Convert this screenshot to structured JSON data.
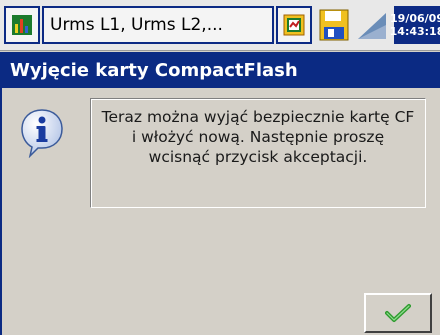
{
  "topbar": {
    "channels_label": "Urms L1, Urms L2,...",
    "clock": {
      "date": "19/06/09",
      "time": "14:43:18"
    },
    "icons": {
      "app": "chart-icon",
      "view": "view-switch-icon",
      "save": "floppy-disk-icon",
      "signal": "signal-icon",
      "alarm": "alarm-icon"
    }
  },
  "dialog": {
    "title": "Wyjęcie karty CompactFlash",
    "message": "Teraz można wyjąć bezpiecznie kartę CF i włożyć nową. Następnie proszę wcisnąć przycisk akceptacji.",
    "icon": "info-icon",
    "ok_icon": "checkmark-icon"
  },
  "colors": {
    "accent": "#0b2a83",
    "background": "#d4d0c8",
    "check": "#2e9b2e"
  }
}
